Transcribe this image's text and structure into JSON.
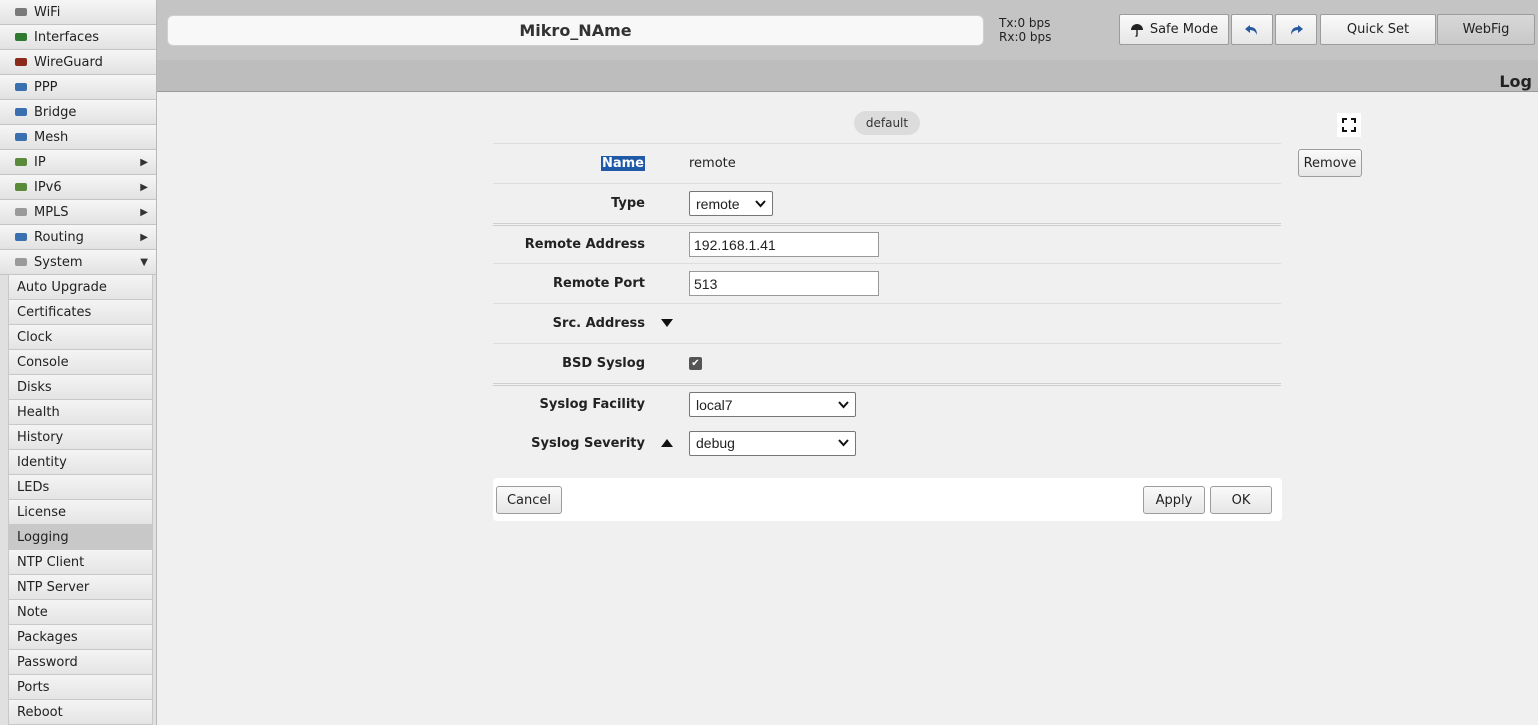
{
  "sidebar": {
    "items": [
      {
        "label": "WiFi",
        "icon": "wifi-icon",
        "arrow": ""
      },
      {
        "label": "Interfaces",
        "icon": "interfaces-icon",
        "arrow": ""
      },
      {
        "label": "WireGuard",
        "icon": "wireguard-icon",
        "arrow": ""
      },
      {
        "label": "PPP",
        "icon": "ppp-icon",
        "arrow": ""
      },
      {
        "label": "Bridge",
        "icon": "bridge-icon",
        "arrow": ""
      },
      {
        "label": "Mesh",
        "icon": "mesh-icon",
        "arrow": ""
      },
      {
        "label": "IP",
        "icon": "ip-icon",
        "arrow": "▶"
      },
      {
        "label": "IPv6",
        "icon": "ipv6-icon",
        "arrow": "▶"
      },
      {
        "label": "MPLS",
        "icon": "mpls-icon",
        "arrow": "▶"
      },
      {
        "label": "Routing",
        "icon": "routing-icon",
        "arrow": "▶"
      },
      {
        "label": "System",
        "icon": "system-icon",
        "arrow": "▼"
      }
    ],
    "subitems": [
      {
        "label": "Auto Upgrade"
      },
      {
        "label": "Certificates"
      },
      {
        "label": "Clock"
      },
      {
        "label": "Console"
      },
      {
        "label": "Disks"
      },
      {
        "label": "Health"
      },
      {
        "label": "History"
      },
      {
        "label": "Identity"
      },
      {
        "label": "LEDs"
      },
      {
        "label": "License"
      },
      {
        "label": "Logging"
      },
      {
        "label": "NTP Client"
      },
      {
        "label": "NTP Server"
      },
      {
        "label": "Note"
      },
      {
        "label": "Packages"
      },
      {
        "label": "Password"
      },
      {
        "label": "Ports"
      },
      {
        "label": "Reboot"
      }
    ],
    "active_subitem": "Logging"
  },
  "header": {
    "identity": "Mikro_NAme",
    "tx": "Tx:0 bps",
    "rx": "Rx:0 bps",
    "safe_mode": "Safe Mode",
    "quick_set": "Quick Set",
    "webfig": "WebFig",
    "page_title": "Log"
  },
  "form": {
    "tag": "default",
    "remove": "Remove",
    "name_label": "Name",
    "name_value": "remote",
    "type_label": "Type",
    "type_value": "remote",
    "remote_address_label": "Remote Address",
    "remote_address_value": "192.168.1.41",
    "remote_port_label": "Remote Port",
    "remote_port_value": "513",
    "src_address_label": "Src. Address",
    "bsd_syslog_label": "BSD Syslog",
    "bsd_syslog_checked": true,
    "syslog_facility_label": "Syslog Facility",
    "syslog_facility_value": "local7",
    "syslog_severity_label": "Syslog Severity",
    "syslog_severity_value": "debug",
    "cancel": "Cancel",
    "apply": "Apply",
    "ok": "OK"
  },
  "colors": {
    "name_highlight": "#1e5aa8",
    "topbar": "#c4c4c4",
    "page_bg": "#f0f0f0"
  }
}
